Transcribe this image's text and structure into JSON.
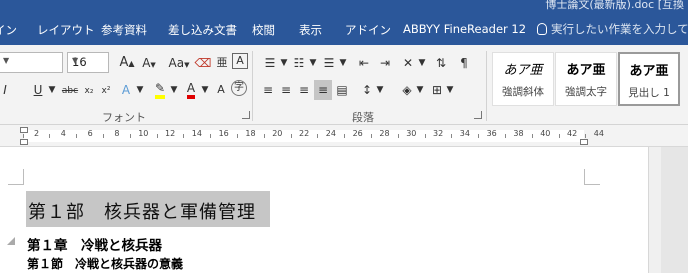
{
  "window": {
    "title_fragment": "博士論文(最新版).doc [互換"
  },
  "tabs": [
    "イン",
    "レイアウト",
    "参考資料",
    "差し込み文書",
    "校閲",
    "表示",
    "アドイン",
    "ABBYY FineReader 12"
  ],
  "tell_me": "実行したい作業を入力してくださ",
  "font": {
    "size": "16",
    "group_label": "フォント"
  },
  "paragraph": {
    "group_label": "段落"
  },
  "styles": [
    {
      "sample": "あア亜",
      "name": "強調斜体"
    },
    {
      "sample": "あア亜",
      "name": "強調太字"
    },
    {
      "sample": "あア亜",
      "name": "見出し 1"
    }
  ],
  "ruler": {
    "numbers": [
      "2",
      "4",
      "6",
      "8",
      "10",
      "12",
      "14",
      "16",
      "18",
      "20",
      "22",
      "24",
      "26",
      "28",
      "30",
      "32",
      "34",
      "36",
      "38",
      "40",
      "42",
      "44"
    ]
  },
  "document": {
    "heading1": "第１部　核兵器と軍備管理",
    "heading2": "第１章　冷戦と核兵器",
    "heading3": "第１節　冷戦と核兵器の意義"
  }
}
